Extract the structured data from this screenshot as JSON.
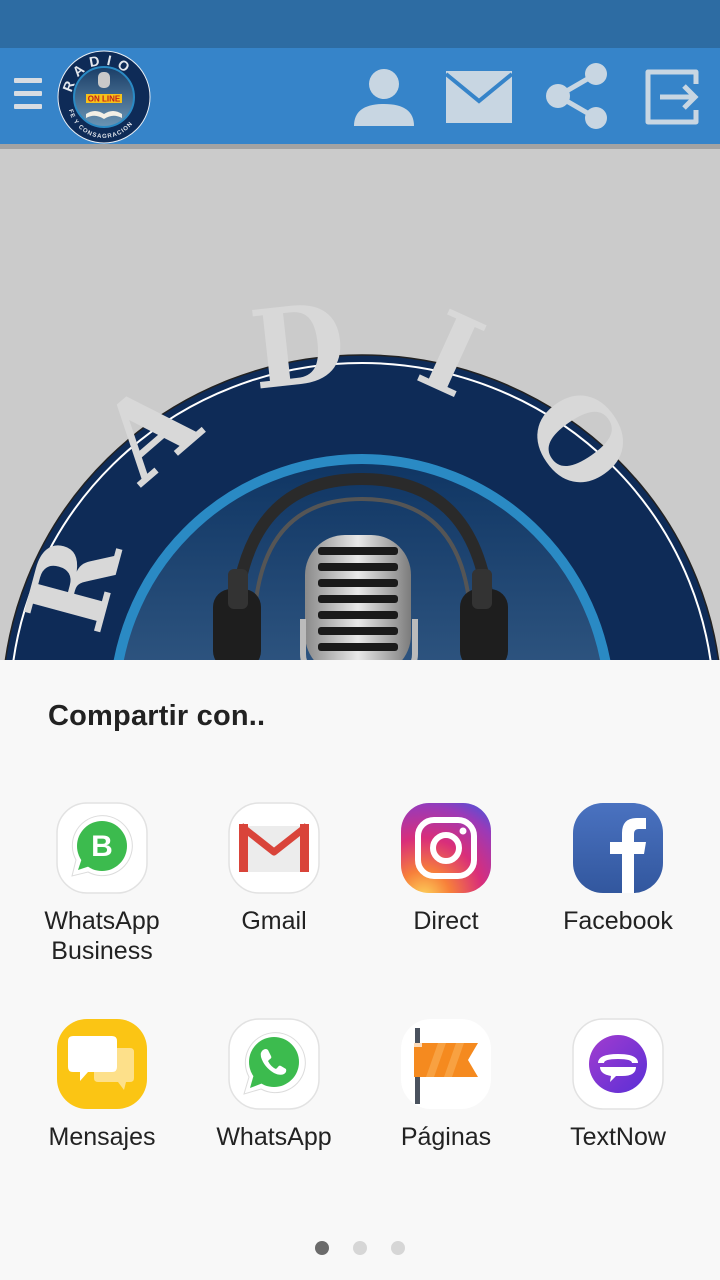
{
  "app": {
    "logo": {
      "top_text": "RADIO",
      "badge_text": "ON LINE",
      "bottom_text": "FE Y CONSAGRACION"
    },
    "colors": {
      "status_bar": "#2d6ca3",
      "app_bar": "#3684c9",
      "icon_tint": "#c8d6e2"
    }
  },
  "toolbar": {
    "menu_icon": "hamburger-menu-icon",
    "actions": [
      {
        "name": "profile",
        "icon": "person-icon"
      },
      {
        "name": "messages",
        "icon": "mail-icon"
      },
      {
        "name": "share",
        "icon": "share-icon"
      },
      {
        "name": "logout",
        "icon": "exit-icon"
      }
    ]
  },
  "hero": {
    "ring_text": "RADIO"
  },
  "share_sheet": {
    "title": "Compartir con..",
    "apps": [
      {
        "label": "WhatsApp\nBusiness",
        "label_line1": "WhatsApp",
        "label_line2": "Business",
        "icon": "whatsapp-business-icon"
      },
      {
        "label": "Gmail",
        "icon": "gmail-icon"
      },
      {
        "label": "Direct",
        "icon": "instagram-direct-icon"
      },
      {
        "label": "Facebook",
        "icon": "facebook-icon"
      },
      {
        "label": "Mensajes",
        "icon": "messages-icon"
      },
      {
        "label": "WhatsApp",
        "icon": "whatsapp-icon"
      },
      {
        "label": "Páginas",
        "icon": "pages-flag-icon"
      },
      {
        "label": "TextNow",
        "icon": "textnow-icon"
      }
    ],
    "pagination": {
      "current_page": 1,
      "total_pages": 3
    }
  }
}
